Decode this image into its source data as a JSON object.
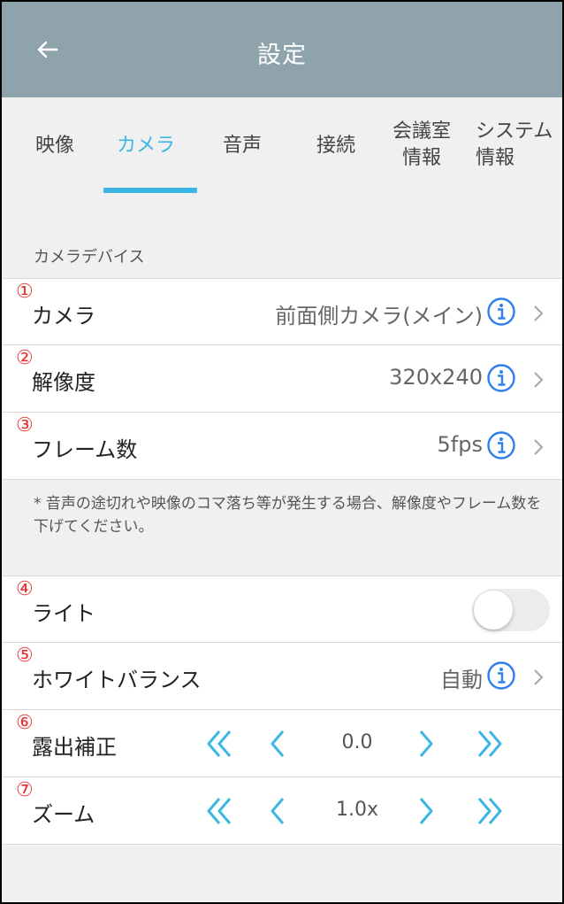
{
  "header": {
    "title": "設定",
    "back_icon": "arrow-left-icon"
  },
  "tabs": [
    {
      "line1": "映像",
      "line2": ""
    },
    {
      "line1": "カメラ",
      "line2": "",
      "active": true
    },
    {
      "line1": "音声",
      "line2": ""
    },
    {
      "line1": "接続",
      "line2": ""
    },
    {
      "line1": "会議室",
      "line2": "情報"
    },
    {
      "line1": "システム",
      "line2": "情報"
    }
  ],
  "section": {
    "label": "カメラデバイス"
  },
  "rows": {
    "camera": {
      "num": "①",
      "label": "カメラ",
      "value": "前面側カメラ(メイン)"
    },
    "resolution": {
      "num": "②",
      "label": "解像度",
      "value": "320x240"
    },
    "framerate": {
      "num": "③",
      "label": "フレーム数",
      "value": "5fps"
    },
    "light": {
      "num": "④",
      "label": "ライト",
      "toggle_on": false
    },
    "white_balance": {
      "num": "⑤",
      "label": "ホワイトバランス",
      "value": "自動"
    },
    "exposure": {
      "num": "⑥",
      "label": "露出補正",
      "value": "0.0"
    },
    "zoom": {
      "num": "⑦",
      "label": "ズーム",
      "value": "1.0x"
    }
  },
  "note": "* 音声の途切れや映像のコマ落ち等が発生する場合、解像度やフレーム数を下げてください。",
  "colors": {
    "accent": "#3cb6e3",
    "header_bg": "#8fa3ad",
    "number_red": "#e53030",
    "info_blue": "#2f80ed"
  }
}
